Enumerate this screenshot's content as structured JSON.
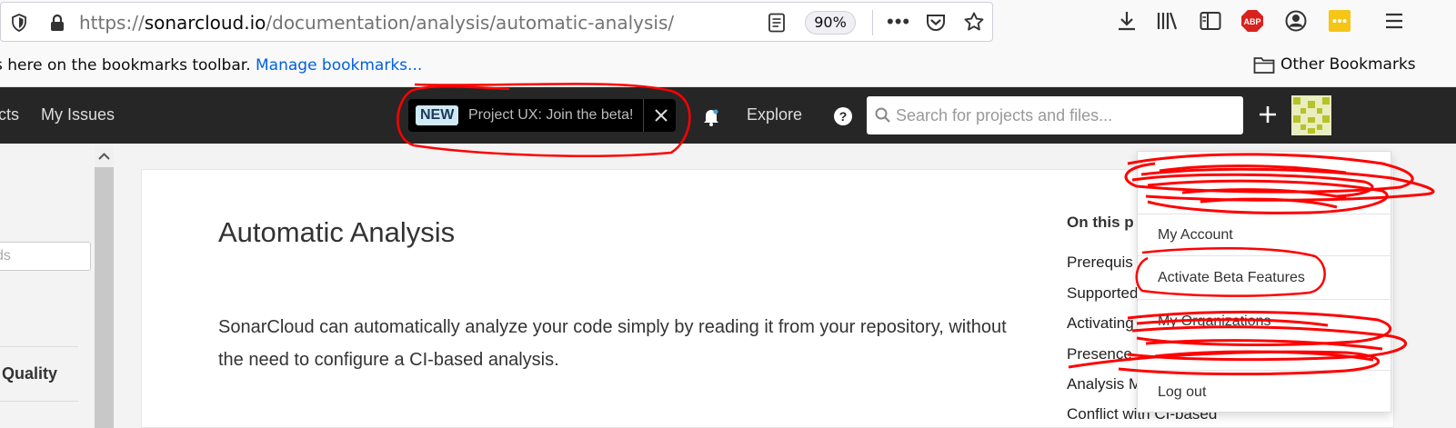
{
  "browser": {
    "url_prefix": "https://",
    "url_host": "sonarcloud.io",
    "url_path": "/documentation/analysis/automatic-analysis/",
    "zoom": "90%",
    "more_glyph": "•••",
    "adblock_label": "ABP",
    "toolbar_icons": [
      "shield-icon",
      "lock-icon",
      "reader-view-icon",
      "pocket-icon",
      "star-icon",
      "download-icon",
      "library-icon",
      "sidebar-icon",
      "adblock-icon",
      "account-icon",
      "extension-icon",
      "menu-icon"
    ],
    "bookmarks_hint": "s here on the bookmarks toolbar. ",
    "bookmarks_link": "Manage bookmarks...",
    "other_bookmarks": "Other Bookmarks"
  },
  "navbar": {
    "projects_partial": "cts",
    "my_issues": "My Issues",
    "beta_badge": "NEW",
    "beta_text": "Project UX: Join the beta!",
    "explore": "Explore",
    "search_placeholder": "Search for projects and files..."
  },
  "sidebar": {
    "filter_partial": "ds",
    "quality_partial": "Quality"
  },
  "page": {
    "title": "Automatic Analysis",
    "paragraph": "SonarCloud can automatically analyze your code simply by reading it from your repository, without the need to configure a CI-based analysis.",
    "toc_title": "On this p",
    "toc_items": [
      "Prerequis",
      "Supported",
      "Activating",
      "Presence",
      "Analysis M",
      "Conflict with CI-based"
    ]
  },
  "dropdown": {
    "my_account": "My Account",
    "activate_beta": "Activate Beta Features",
    "my_organizations": "My Organizations",
    "log_out": "Log out"
  },
  "colors": {
    "navbar": "#262626",
    "annotation": "#ff0000",
    "link": "#0060df"
  }
}
